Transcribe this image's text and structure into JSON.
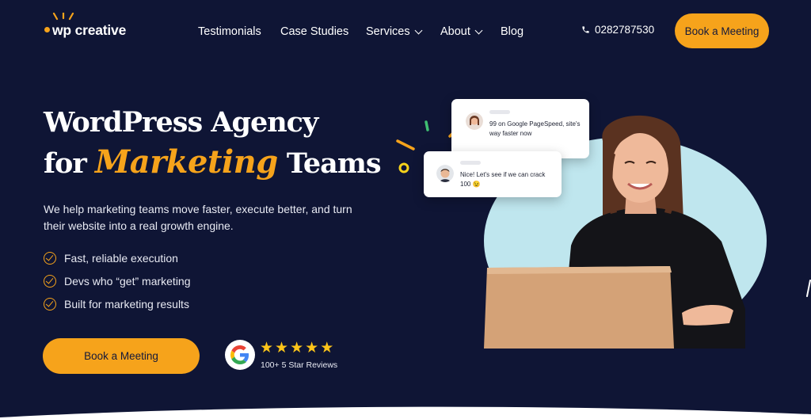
{
  "brand": {
    "logo_text": "wp creative"
  },
  "nav": {
    "items": [
      {
        "label": "Testimonials",
        "dropdown": false
      },
      {
        "label": "Case Studies",
        "dropdown": false
      },
      {
        "label": "Services",
        "dropdown": true
      },
      {
        "label": "About",
        "dropdown": true
      },
      {
        "label": "Blog",
        "dropdown": false
      }
    ]
  },
  "header": {
    "phone": "0282787530",
    "cta_label": "Book a Meeting"
  },
  "hero": {
    "title_line1": "WordPress Agency",
    "title_for": "for",
    "title_script": "Marketing",
    "title_end": "Teams",
    "subtitle": "We help marketing teams move faster, execute better, and turn their website into a real growth engine.",
    "checks": [
      "Fast, reliable execution",
      "Devs who “get” marketing",
      "Built for marketing results"
    ],
    "cta_label": "Book a Meeting"
  },
  "reviews": {
    "stars": 5,
    "text": "100+ 5 Star Reviews"
  },
  "chat": {
    "message1": "99 on Google PageSpeed, site's way faster now",
    "message2": "Nice! Let's see if we can crack 100 😉"
  },
  "colors": {
    "background": "#0f1535",
    "accent": "#f6a31b",
    "circle": "#bfe6ee",
    "star": "#fcc419"
  },
  "icons": [
    "phone-icon",
    "check-circle-icon",
    "google-icon",
    "star-icon",
    "chevron-down-icon"
  ]
}
